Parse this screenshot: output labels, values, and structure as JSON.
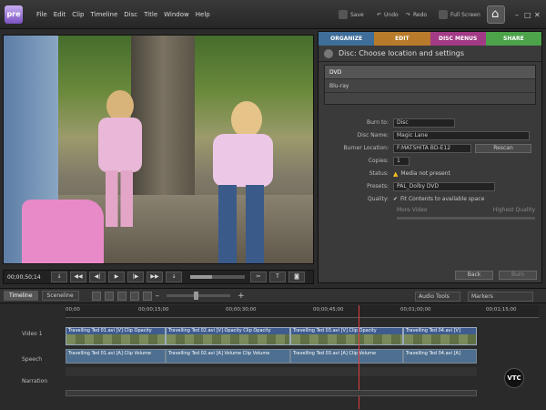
{
  "app": {
    "logo": "pre"
  },
  "menu": [
    "File",
    "Edit",
    "Clip",
    "Timeline",
    "Disc",
    "Title",
    "Window",
    "Help"
  ],
  "toolbar": {
    "save": "Save",
    "undo": "Undo",
    "redo": "Redo",
    "fullscreen": "Full Screen"
  },
  "monitor": {
    "timecode": "00;00;50;14"
  },
  "tabs": {
    "organize": "ORGANIZE",
    "edit": "EDIT",
    "disc": "DISC MENUS",
    "share": "SHARE"
  },
  "panel": {
    "heading": "Disc: Choose location and settings",
    "disc_types": [
      "DVD",
      "Blu-ray"
    ],
    "burn_to_label": "Burn to:",
    "burn_to": "Disc",
    "disc_name_label": "Disc Name:",
    "disc_name": "Magic Lane",
    "burner_label": "Burner Location:",
    "burner": "F:MATSHITA BD-E12",
    "rescan": "Rescan",
    "copies_label": "Copies:",
    "copies": "1",
    "status_label": "Status:",
    "status": "Media not present",
    "presets_label": "Presets:",
    "preset": "PAL_Dolby DVD",
    "quality_label": "Quality:",
    "quality_opt": "Fit Contents to available space",
    "more_video": "More Video",
    "highest_quality": "Highest Quality",
    "back": "Back",
    "burn": "Burn"
  },
  "timeline": {
    "tab_timeline": "Timeline",
    "tab_sceneline": "Sceneline",
    "audio_tools": "Audio Tools",
    "markers": "Markers",
    "ruler": [
      "00;00",
      "00;00;15;00",
      "00;00;30;00",
      "00;00;45;00",
      "00;01;00;00",
      "00;01;15;00"
    ],
    "tracks": {
      "video": "Video 1",
      "speech": "Speech",
      "narration": "Narration"
    },
    "video_clips": [
      "Travelling Ted 01.avi [V] Clip Opacity",
      "Travelling Ted 02.avi [V] Opacity Clip Opacity",
      "Travelling Ted 03.avi [V] Clip Opacity",
      "Travelling Ted 04.avi [V]"
    ],
    "audio_clips": [
      "Travelling Ted 01.avi [A] Clip Volume",
      "Travelling Ted 02.avi [A] Volume Clip Volume",
      "Travelling Ted 03.avi [A] Clip Volume",
      "Travelling Ted 04.avi [A]"
    ]
  },
  "watermark": "VTC"
}
